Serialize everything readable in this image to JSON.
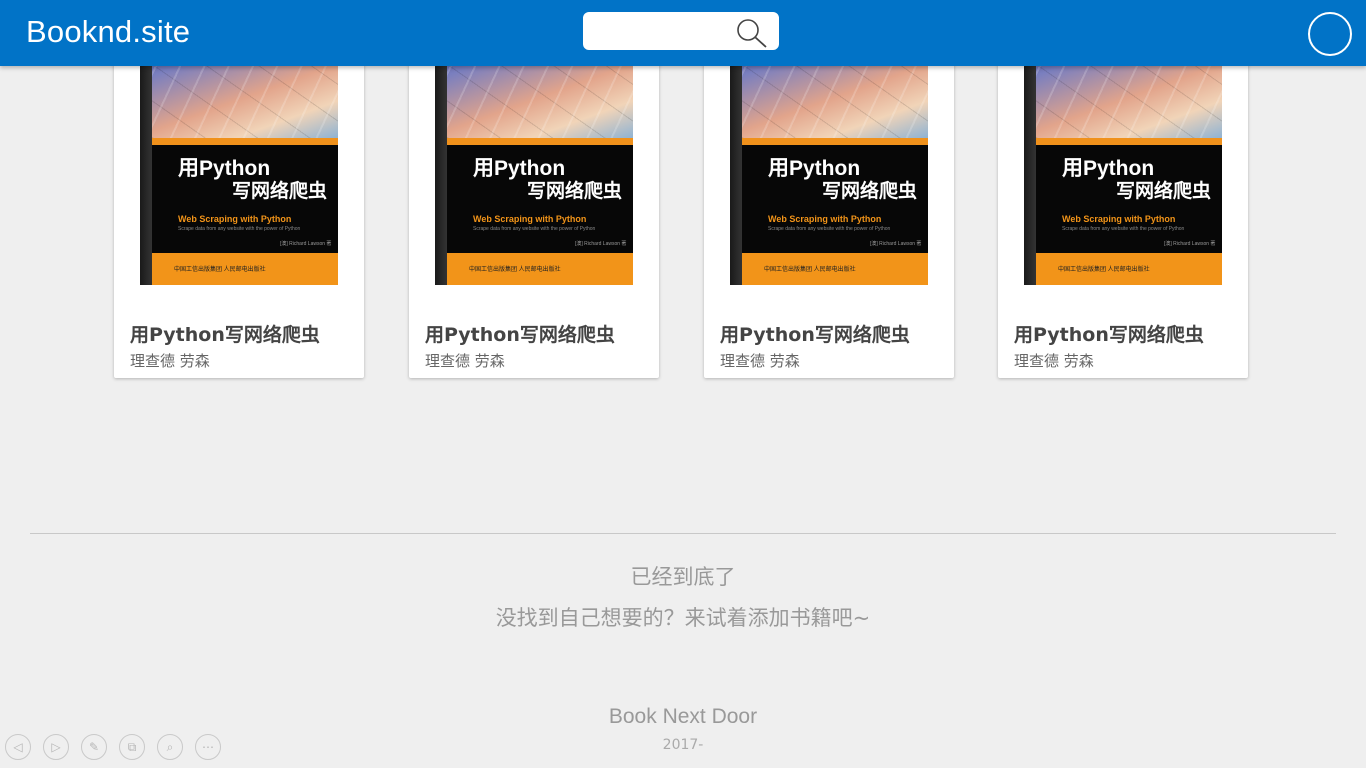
{
  "header": {
    "brand": "Booknd.site",
    "search": {
      "value": "",
      "placeholder": ""
    }
  },
  "books": [
    {
      "title": "用Python写网络爬虫",
      "author": "理查德 劳森",
      "cover": {
        "title_line1": "用Python",
        "title_line2": "写网络爬虫",
        "subtitle": "Web Scraping with Python",
        "tagline": "Scrape data from any website with the power of Python",
        "author_line": "[澳] Richard Lawson 著",
        "publisher": "中国工信出版集团  人民邮电出版社"
      }
    },
    {
      "title": "用Python写网络爬虫",
      "author": "理查德 劳森",
      "cover": {
        "title_line1": "用Python",
        "title_line2": "写网络爬虫",
        "subtitle": "Web Scraping with Python",
        "tagline": "Scrape data from any website with the power of Python",
        "author_line": "[澳] Richard Lawson 著",
        "publisher": "中国工信出版集团  人民邮电出版社"
      }
    },
    {
      "title": "用Python写网络爬虫",
      "author": "理查德 劳森",
      "cover": {
        "title_line1": "用Python",
        "title_line2": "写网络爬虫",
        "subtitle": "Web Scraping with Python",
        "tagline": "Scrape data from any website with the power of Python",
        "author_line": "[澳] Richard Lawson 著",
        "publisher": "中国工信出版集团  人民邮电出版社"
      }
    },
    {
      "title": "用Python写网络爬虫",
      "author": "理查德 劳森",
      "cover": {
        "title_line1": "用Python",
        "title_line2": "写网络爬虫",
        "subtitle": "Web Scraping with Python",
        "tagline": "Scrape data from any website with the power of Python",
        "author_line": "[澳] Richard Lawson 著",
        "publisher": "中国工信出版集团  人民邮电出版社"
      }
    }
  ],
  "end": {
    "message": "已经到底了",
    "hint": "没找到自己想要的？来试着添加书籍吧~"
  },
  "footer": {
    "title": "Book Next Door",
    "year": "2017-"
  },
  "tools": [
    {
      "icon": "arrow-left-icon",
      "glyph": "◁"
    },
    {
      "icon": "arrow-right-icon",
      "glyph": "▷"
    },
    {
      "icon": "pen-icon",
      "glyph": "✎"
    },
    {
      "icon": "copy-icon",
      "glyph": "⧉"
    },
    {
      "icon": "zoom-icon",
      "glyph": "⌕"
    },
    {
      "icon": "more-icon",
      "glyph": "⋯"
    }
  ],
  "colors": {
    "header": "#0173c7",
    "background": "#efefef",
    "cover_accent": "#f29419"
  }
}
